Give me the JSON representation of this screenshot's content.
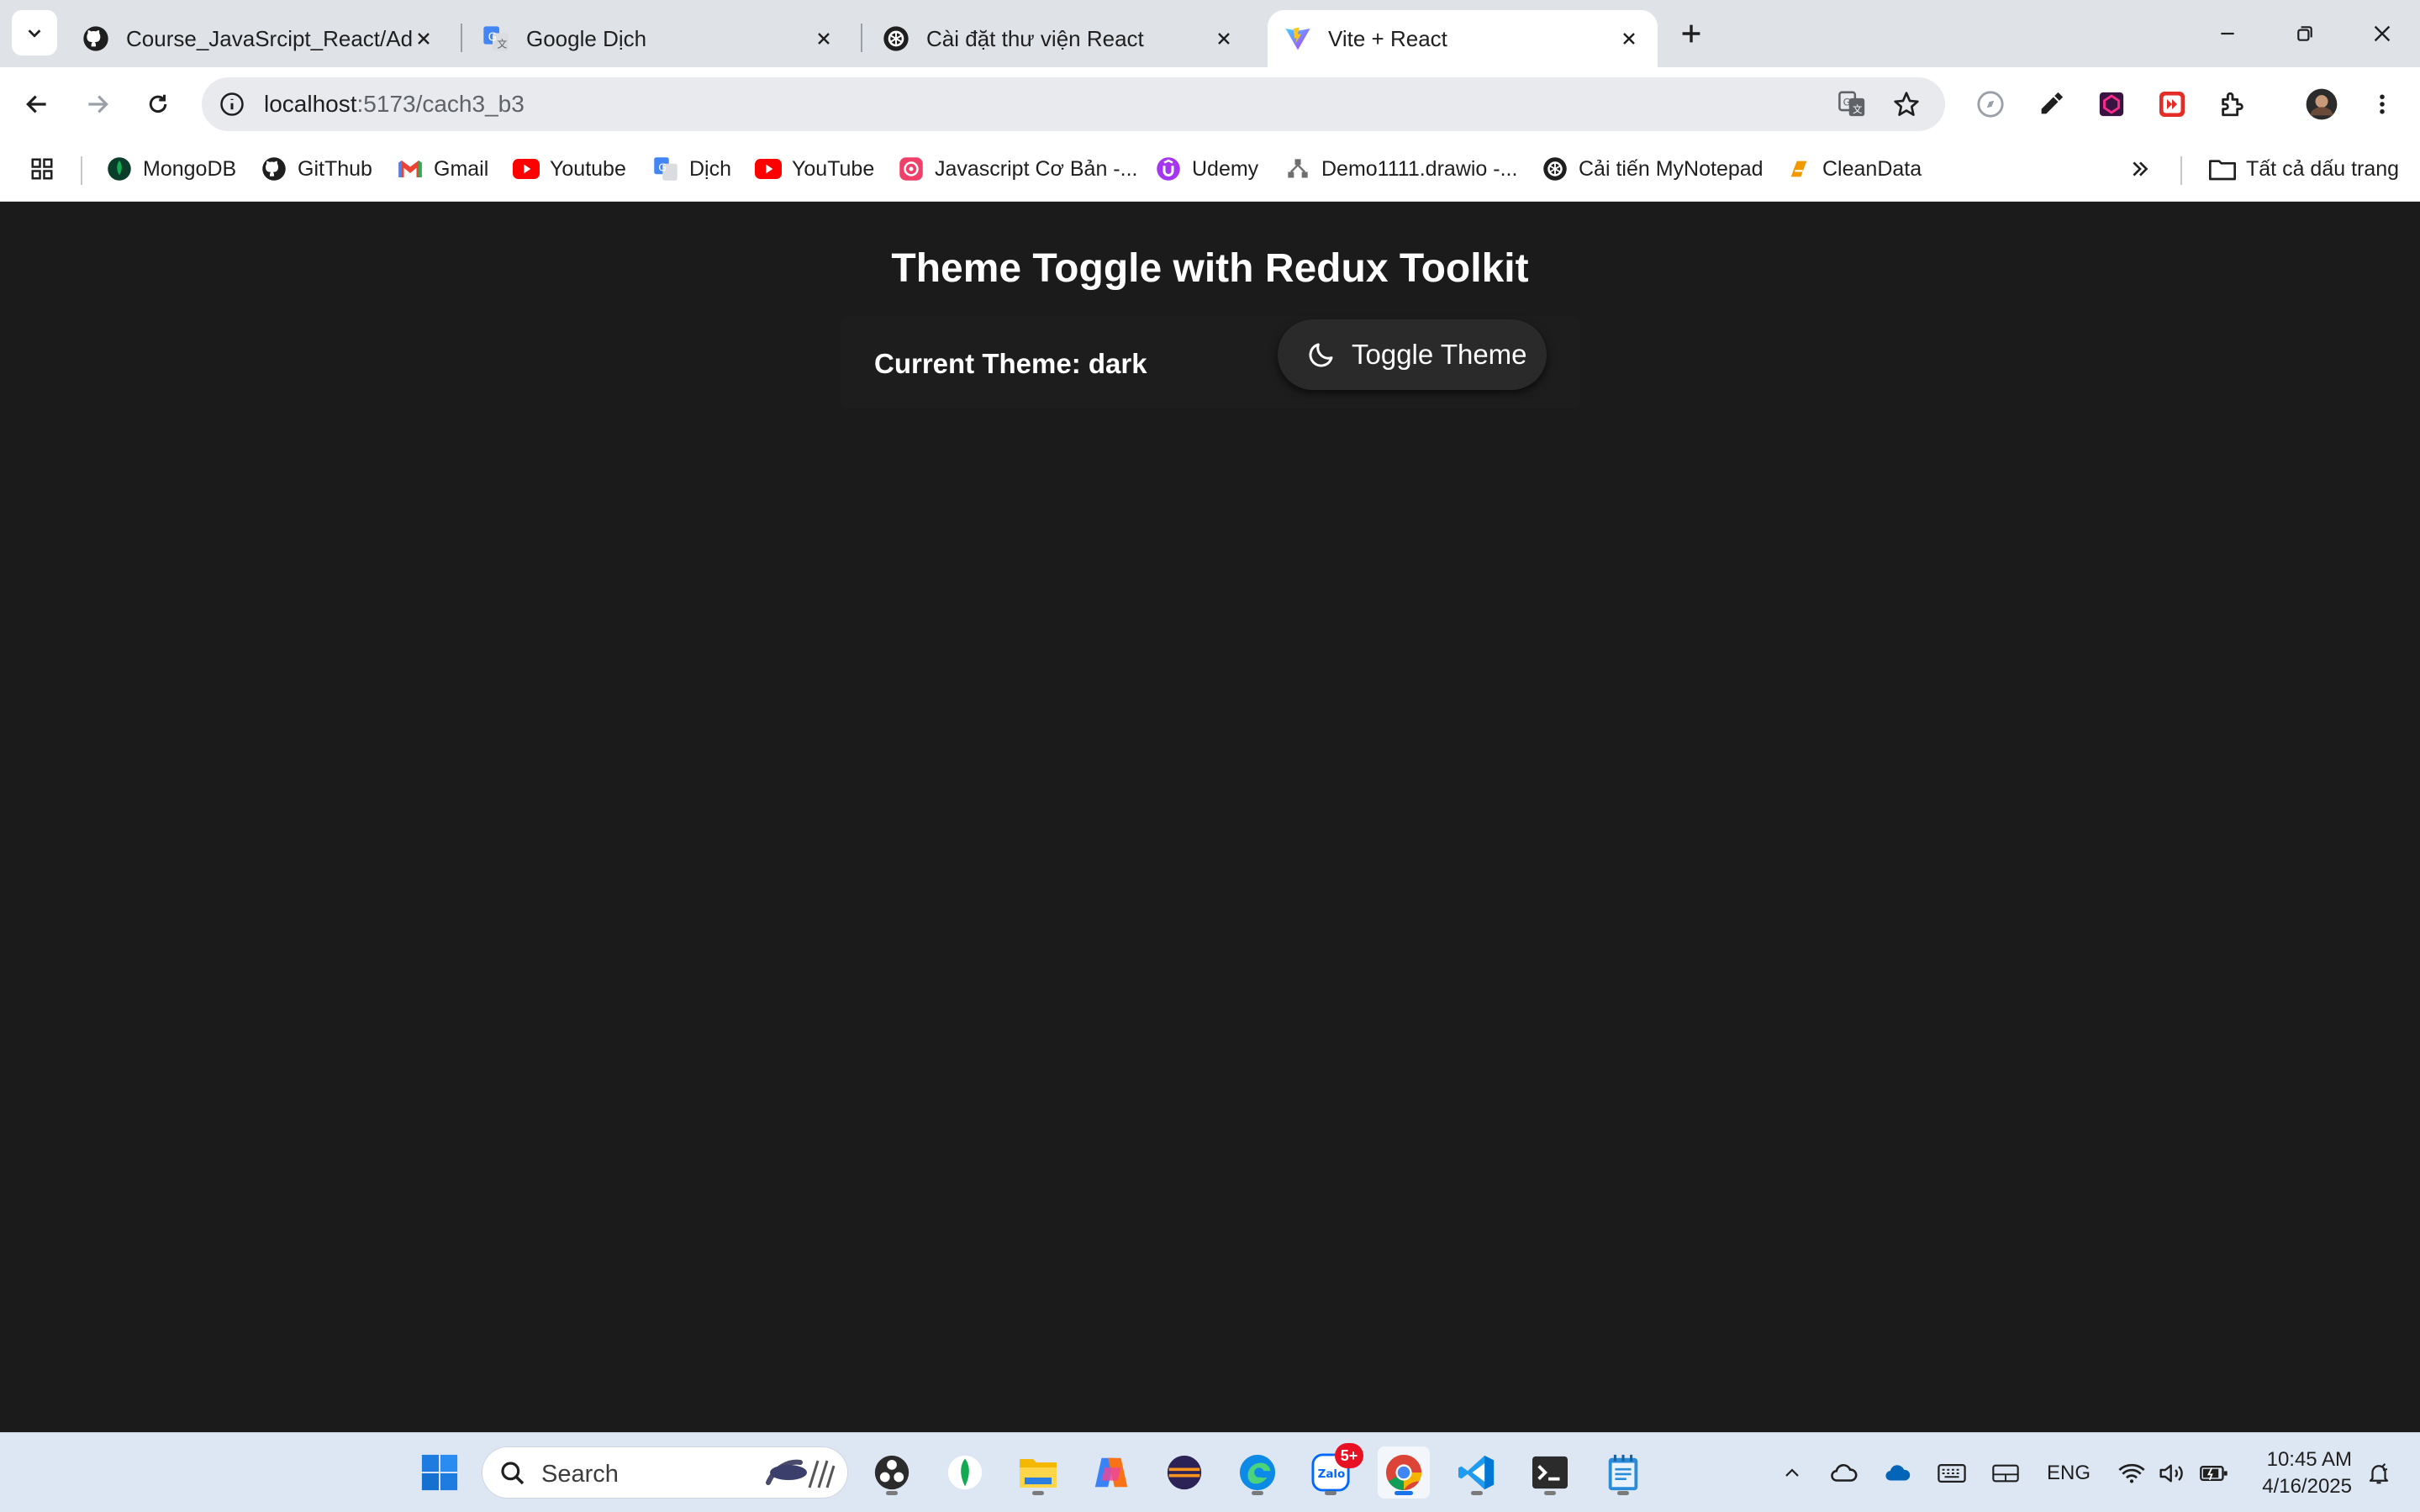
{
  "browser": {
    "tabs": [
      {
        "title": "Course_JavaSrcipt_React/Admin",
        "icon": "github-icon",
        "active": false
      },
      {
        "title": "Google Dịch",
        "icon": "google-translate-icon",
        "active": false
      },
      {
        "title": "Cài đặt thư viện React",
        "icon": "chatgpt-icon",
        "active": false
      },
      {
        "title": "Vite + React",
        "icon": "vite-icon",
        "active": true
      }
    ],
    "url_host": "localhost",
    "url_path": ":5173/cach3_b3",
    "bookmarks": [
      {
        "label": "MongoDB",
        "icon": "mongodb-leaf-icon"
      },
      {
        "label": "GitThub",
        "icon": "github-icon"
      },
      {
        "label": "Gmail",
        "icon": "gmail-icon"
      },
      {
        "label": "Youtube",
        "icon": "youtube-icon"
      },
      {
        "label": "Dịch",
        "icon": "google-translate-icon"
      },
      {
        "label": "YouTube",
        "icon": "youtube-icon"
      },
      {
        "label": "Javascript Cơ Bản -...",
        "icon": "course-icon"
      },
      {
        "label": "Udemy",
        "icon": "udemy-icon"
      },
      {
        "label": "Demo1111.drawio -...",
        "icon": "drawio-icon"
      },
      {
        "label": "Cải tiến MyNotepad",
        "icon": "chatgpt-icon"
      },
      {
        "label": "CleanData",
        "icon": "cleandata-icon"
      }
    ],
    "all_bookmarks_label": "Tất cả dấu trang"
  },
  "page": {
    "title": "Theme Toggle with Redux Toolkit",
    "current_theme_label": "Current Theme: dark",
    "toggle_button_label": "Toggle Theme",
    "toggle_icon": "moon-icon"
  },
  "taskbar": {
    "search_placeholder": "Search",
    "apps": [
      "windows-start-icon",
      "obs-icon",
      "mongodb-compass-icon",
      "file-explorer-icon",
      "copilot-icon",
      "eclipse-icon",
      "edge-icon",
      "zalo-icon",
      "chrome-icon",
      "vscode-icon",
      "terminal-icon",
      "notepad-icon"
    ],
    "zalo_badge": "5+",
    "language": "ENG",
    "time": "10:45 AM",
    "date": "4/16/2025"
  },
  "colors": {
    "page_background": "#1b1b1b",
    "button_background": "#2a2a2a",
    "text": "#ffffff"
  }
}
